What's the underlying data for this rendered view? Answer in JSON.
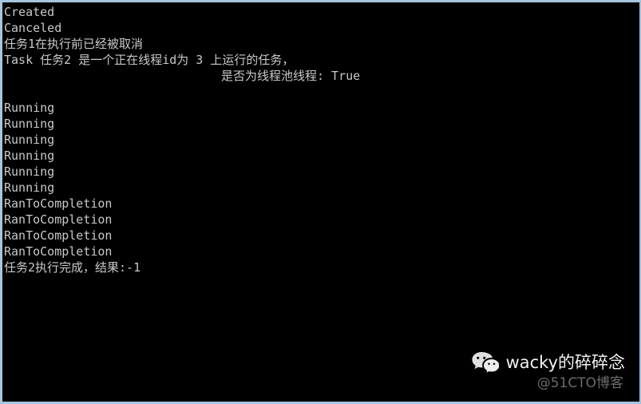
{
  "window": {
    "kind": "console-terminal",
    "background_color": "#000000",
    "text_color": "#c8c8c8",
    "border_color": "#a8c6e0"
  },
  "console": {
    "lines": [
      {
        "text": "Created",
        "indented": false
      },
      {
        "text": "Canceled",
        "indented": false
      },
      {
        "text": "任务1在执行前已经被取消",
        "indented": false
      },
      {
        "text": "Task 任务2 是一个正在线程id为 3 上运行的任务，",
        "indented": false
      },
      {
        "text": "是否为线程池线程: True",
        "indented": true
      },
      {
        "text": "",
        "indented": false
      },
      {
        "text": "Running",
        "indented": false
      },
      {
        "text": "Running",
        "indented": false
      },
      {
        "text": "Running",
        "indented": false
      },
      {
        "text": "Running",
        "indented": false
      },
      {
        "text": "Running",
        "indented": false
      },
      {
        "text": "Running",
        "indented": false
      },
      {
        "text": "RanToCompletion",
        "indented": false
      },
      {
        "text": "RanToCompletion",
        "indented": false
      },
      {
        "text": "RanToCompletion",
        "indented": false
      },
      {
        "text": "RanToCompletion",
        "indented": false
      },
      {
        "text": "任务2执行完成，结果:-1",
        "indented": false
      }
    ]
  },
  "watermark": {
    "icon": "wechat-icon",
    "name": "wacky的碎碎念",
    "source": "@51CTO博客",
    "name_color": "#f2f2f2",
    "source_color": "#6b6b6b"
  }
}
